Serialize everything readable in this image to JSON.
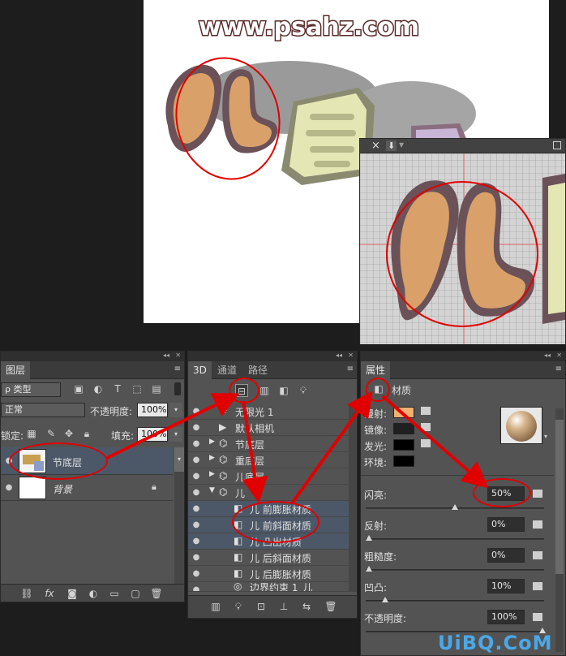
{
  "canvas": {
    "watermark": "www.psahz.com"
  },
  "preview": {
    "close": "×",
    "save": "⬇"
  },
  "layers_panel": {
    "tab": "图层",
    "filter_label": "ρ 类型",
    "blend_mode": "正常",
    "opacity_label": "不透明度:",
    "opacity_value": "100%",
    "lock_label": "锁定:",
    "fill_label": "填充:",
    "fill_value": "100%",
    "layers": [
      {
        "name": "节底层"
      },
      {
        "name": "背景"
      }
    ]
  },
  "panel_3d": {
    "tabs": [
      "3D",
      "通道",
      "路径"
    ],
    "items": [
      {
        "name": "无限光 1"
      },
      {
        "name": "默认相机"
      },
      {
        "name": "节底层"
      },
      {
        "name": "重底层"
      },
      {
        "name": "儿底层"
      },
      {
        "name": "儿"
      },
      {
        "name": "儿 前膨胀材质"
      },
      {
        "name": "儿 前斜面材质"
      },
      {
        "name": "儿 凸出材质"
      },
      {
        "name": "儿 后斜面材质"
      },
      {
        "name": "儿 后膨胀材质"
      },
      {
        "name": "边界约束 1_儿"
      }
    ]
  },
  "properties_panel": {
    "tab": "属性",
    "section": "材质",
    "diffuse_label": "漫射:",
    "specular_label": "镜像:",
    "illumination_label": "发光:",
    "ambient_label": "环境:",
    "shine_label": "闪亮:",
    "shine_value": "50%",
    "reflection_label": "反射:",
    "reflection_value": "0%",
    "roughness_label": "粗糙度:",
    "roughness_value": "0%",
    "bump_label": "凹凸:",
    "bump_value": "10%",
    "opacity_label": "不透明度:",
    "opacity_value": "100%",
    "colors": {
      "diffuse": "#f0b070",
      "specular": "#202020",
      "illumination": "#000000",
      "ambient": "#000000"
    },
    "sliders": {
      "shine": 0.5,
      "reflection": 0,
      "roughness": 0,
      "bump": 0.1,
      "opacity": 1
    }
  },
  "footer_watermark": "UiBQ.CoM"
}
